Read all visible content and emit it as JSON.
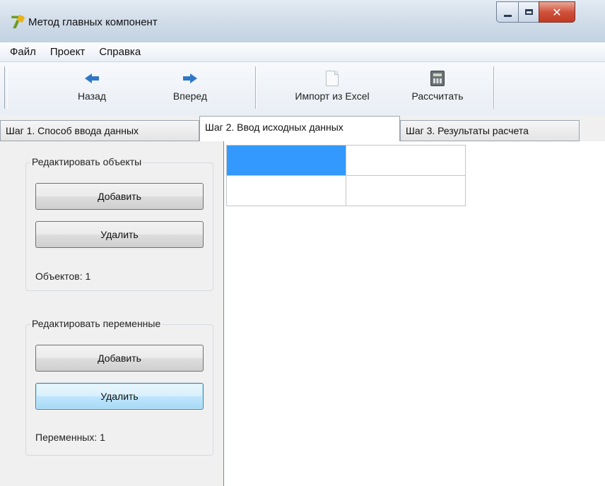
{
  "window": {
    "title": "Метод главных компонент"
  },
  "menu": {
    "items": [
      "Файл",
      "Проект",
      "Справка"
    ]
  },
  "toolbar": {
    "back_label": "Назад",
    "forward_label": "Вперед",
    "import_label": "Импорт из Excel",
    "calculate_label": "Рассчитать"
  },
  "tabs": [
    {
      "label": "Шаг 1. Способ ввода данных",
      "active": false
    },
    {
      "label": "Шаг 2. Ввод исходных данных",
      "active": true
    },
    {
      "label": "Шаг 3. Результаты расчета",
      "active": false
    }
  ],
  "objects_group": {
    "legend": "Редактировать объекты",
    "add_label": "Добавить",
    "delete_label": "Удалить",
    "count_text": "Объектов: 1"
  },
  "variables_group": {
    "legend": "Редактировать переменные",
    "add_label": "Добавить",
    "delete_label": "Удалить",
    "count_text": "Переменных: 1"
  },
  "grid": {
    "rows": [
      [
        "",
        ""
      ],
      [
        "",
        ""
      ]
    ],
    "selected_color": "#3399ff"
  },
  "icons": {
    "back": "arrow-left-icon",
    "forward": "arrow-right-icon",
    "import": "document-icon",
    "calculate": "calculator-icon"
  }
}
